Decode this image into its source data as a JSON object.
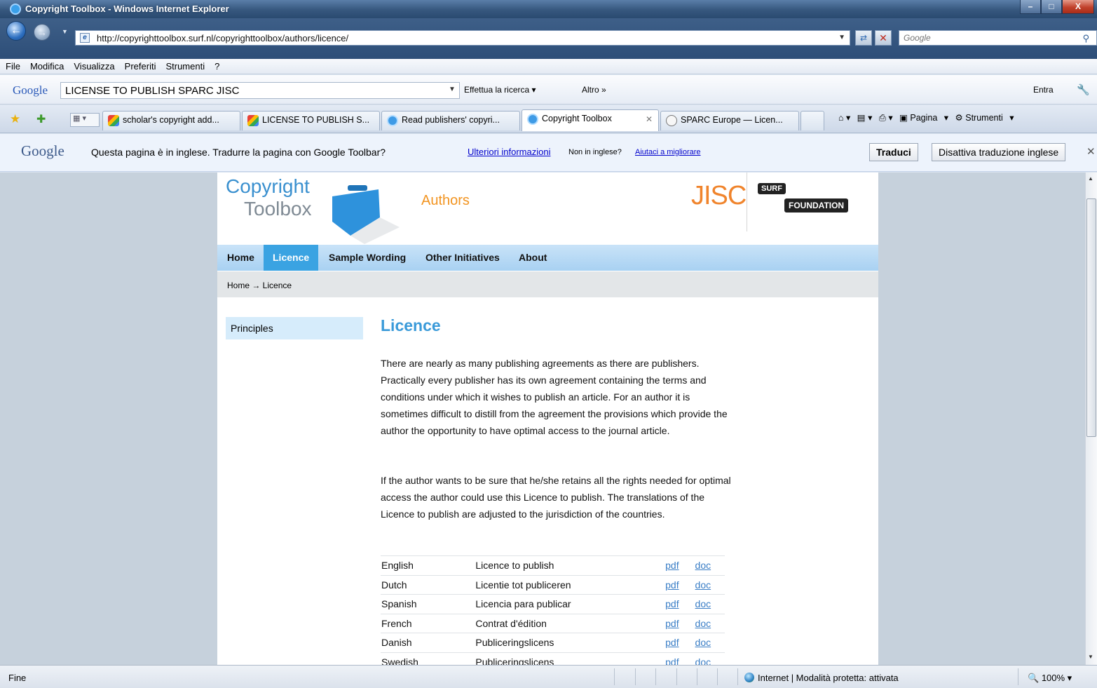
{
  "window": {
    "title": "Copyright Toolbox - Windows Internet Explorer",
    "controls": {
      "minimize": "–",
      "maximize": "□",
      "close": "X"
    }
  },
  "address_bar": {
    "url": "http://copyrighttoolbox.surf.nl/copyrighttoolbox/authors/licence/",
    "search_placeholder": "Google"
  },
  "menu": [
    "File",
    "Modifica",
    "Visualizza",
    "Preferiti",
    "Strumenti",
    "?"
  ],
  "google_toolbar": {
    "logo": "Google",
    "query": "LICENSE TO PUBLISH SPARC JISC",
    "search_label": "Effettua la ricerca",
    "more_label": "Altro »",
    "sign_in": "Entra"
  },
  "tabs": [
    {
      "label": "scholar's copyright add...",
      "icon": "google-icon",
      "active": false
    },
    {
      "label": "LICENSE TO PUBLISH S...",
      "icon": "google-icon",
      "active": false
    },
    {
      "label": "Read publishers' copyri...",
      "icon": "ie-icon",
      "active": false
    },
    {
      "label": "Copyright Toolbox",
      "icon": "ie-icon",
      "active": true
    },
    {
      "label": "SPARC Europe — Licen...",
      "icon": "sparc-icon",
      "active": false
    }
  ],
  "command_bar": {
    "page": "Pagina",
    "tools": "Strumenti"
  },
  "translation_bar": {
    "logo": "Google",
    "message": "Questa pagina è in inglese. Tradurre la pagina con Google Toolbar?",
    "more_info": "Ulteriori informazioni",
    "not_english": "Non in inglese?",
    "help_improve": "Aiutaci a migliorare",
    "translate_button": "Traduci",
    "disable_button": "Disattiva traduzione inglese"
  },
  "site": {
    "logo_line1": "Copyright",
    "logo_line2": "Toolbox",
    "section": "Authors",
    "partner1": "JISC",
    "partner2_top": "SURF",
    "partner2_bottom": "FOUNDATION",
    "nav": [
      "Home",
      "Licence",
      "Sample Wording",
      "Other Initiatives",
      "About"
    ],
    "nav_active": "Licence",
    "breadcrumb": "Home → Licence",
    "sidebar": [
      "Principles"
    ],
    "heading": "Licence",
    "paragraph1": "There are nearly as many publishing agreements as there are publishers. Practically every publisher has its own agreement containing the terms and conditions under which it wishes to publish an article. For an author it is sometimes difficult to distill from the agreement the provisions which provide the author the opportunity to have optimal access to the journal article.",
    "paragraph2": "If the author wants to be sure that he/she retains all the rights needed for optimal access the author could use this Licence to publish. The translations of the Licence to publish are adjusted to the jurisdiction of the countries.",
    "licences": [
      {
        "language": "English",
        "title": "Licence to publish",
        "pdf": "pdf",
        "doc": "doc"
      },
      {
        "language": "Dutch",
        "title": "Licentie tot publiceren",
        "pdf": "pdf",
        "doc": "doc"
      },
      {
        "language": "Spanish",
        "title": "Licencia para publicar",
        "pdf": "pdf",
        "doc": "doc"
      },
      {
        "language": "French",
        "title": "Contrat d'édition",
        "pdf": "pdf",
        "doc": "doc"
      },
      {
        "language": "Danish",
        "title": "Publiceringslicens",
        "pdf": "pdf",
        "doc": "doc"
      },
      {
        "language": "Swedish",
        "title": "Publiceringslicens",
        "pdf": "pdf",
        "doc": "doc"
      }
    ]
  },
  "status_bar": {
    "status": "Fine",
    "zone": "Internet | Modalità protetta: attivata",
    "zoom": "100%"
  }
}
